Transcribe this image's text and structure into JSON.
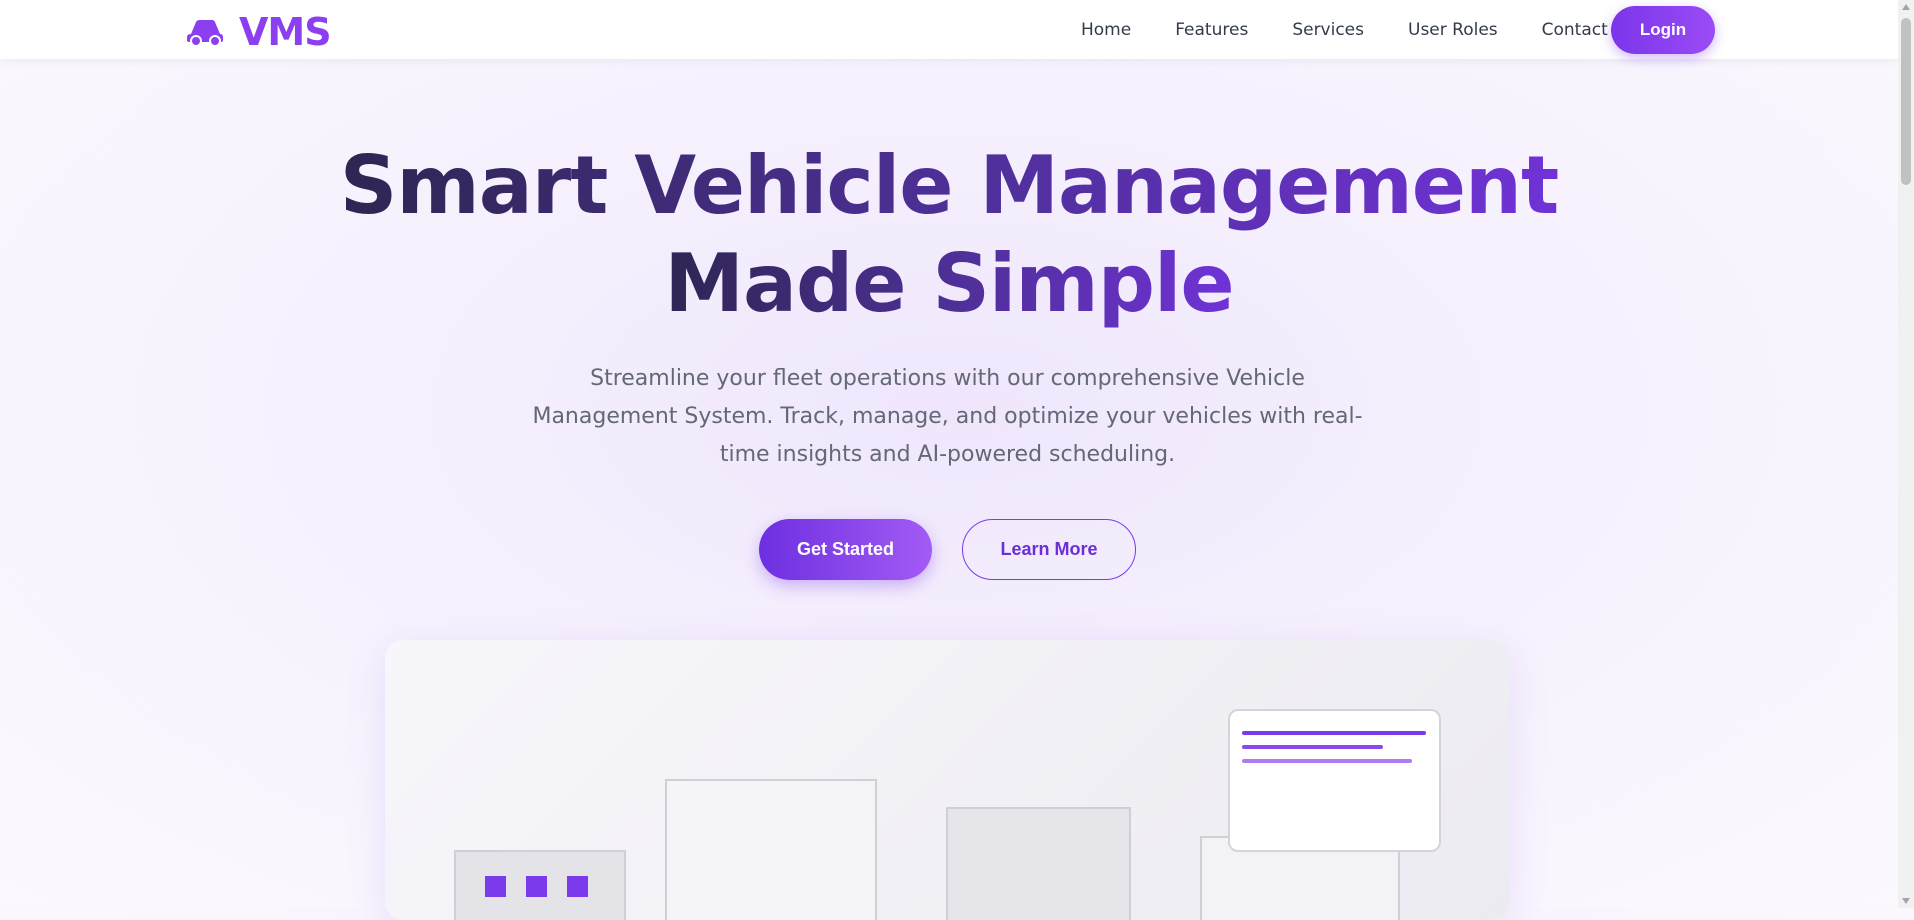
{
  "brand": {
    "name": "VMS",
    "logo_icon": "car-icon",
    "accent": "#8b3ff0"
  },
  "nav": {
    "items": [
      "Home",
      "Features",
      "Services",
      "User Roles",
      "Contact"
    ],
    "login_label": "Login"
  },
  "hero": {
    "title_line1": "Smart Vehicle Management",
    "title_line2": "Made Simple",
    "subtitle": "Streamline your fleet operations with our comprehensive Vehicle Management System. Track, manage, and optimize your vehicles with real-time insights and AI-powered scheduling.",
    "primary_cta": "Get Started",
    "secondary_cta": "Learn More"
  },
  "colors": {
    "primary": "#7c3aed",
    "title_dark": "#2f2552",
    "title_light": "#7032d6",
    "text_muted": "#636877"
  }
}
